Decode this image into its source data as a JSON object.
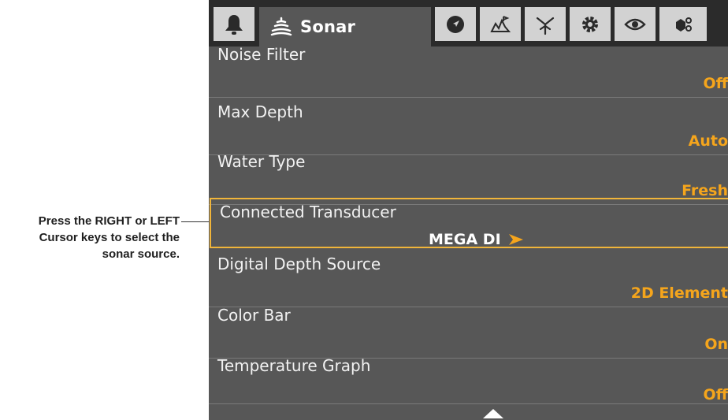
{
  "callout": {
    "line1": "Press the RIGHT or LEFT",
    "line2": "Cursor keys to select the",
    "line3": "sonar source."
  },
  "tabs": [
    {
      "icon": "bell-icon"
    },
    {
      "icon": "sonar-icon",
      "label": "Sonar"
    },
    {
      "icon": "navigation-icon"
    },
    {
      "icon": "chart-icon"
    },
    {
      "icon": "fish-id-icon"
    },
    {
      "icon": "settings-gear-icon"
    },
    {
      "icon": "eye-icon"
    },
    {
      "icon": "accessories-icon"
    }
  ],
  "menu": [
    {
      "label": "Noise Filter",
      "value": "Off"
    },
    {
      "label": "Max Depth",
      "value": "Auto"
    },
    {
      "label": "Water Type",
      "value": "Fresh"
    },
    {
      "label": "Connected Transducer",
      "value": "MEGA DI",
      "selected": true
    },
    {
      "label": "Digital Depth Source",
      "value": "2D Element"
    },
    {
      "label": "Color Bar",
      "value": "On"
    },
    {
      "label": "Temperature Graph",
      "value": "Off"
    }
  ],
  "colors": {
    "value_text": "#f5a51c",
    "selection_border": "#f0b53a",
    "menu_background": "#575757",
    "tab_background": "#d2d2d2"
  }
}
